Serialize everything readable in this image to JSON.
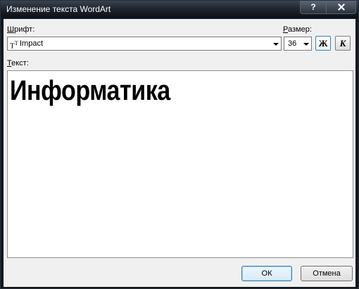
{
  "window": {
    "title": "Изменение текста WordArt"
  },
  "titlebar": {
    "help_label": "?"
  },
  "font": {
    "label_u": "Ш",
    "label_rest": "рифт:",
    "icon_text": "Ŧ",
    "value": "Impact"
  },
  "size": {
    "label_u": "Р",
    "label_rest": "азмер:",
    "value": "36"
  },
  "style": {
    "bold_label": "Ж",
    "italic_label": "К",
    "bold_active": true
  },
  "text": {
    "label_u": "Т",
    "label_rest": "екст:",
    "value": "Информатика"
  },
  "buttons": {
    "ok_label": "ОК",
    "cancel_label": "Отмена"
  }
}
